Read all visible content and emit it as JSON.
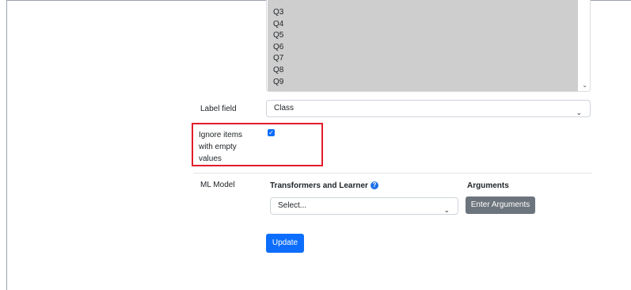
{
  "fields_list": {
    "items": [
      "Q3",
      "Q4",
      "Q5",
      "Q6",
      "Q7",
      "Q8",
      "Q9"
    ]
  },
  "label_field": {
    "label": "Label field",
    "value": "Class"
  },
  "ignore_empty": {
    "label_lines": [
      "Ignore items",
      "with empty",
      "values"
    ],
    "checked": true
  },
  "ml_model": {
    "label": "ML Model",
    "transformers_header": "Transformers and Learner",
    "arguments_header": "Arguments",
    "select_placeholder": "Select...",
    "enter_arguments_label": "Enter Arguments"
  },
  "update_label": "Update",
  "colors": {
    "primary": "#0d6efd",
    "secondary": "#6c757d",
    "highlight": "#e11d2a",
    "list_selection": "#cecece"
  }
}
